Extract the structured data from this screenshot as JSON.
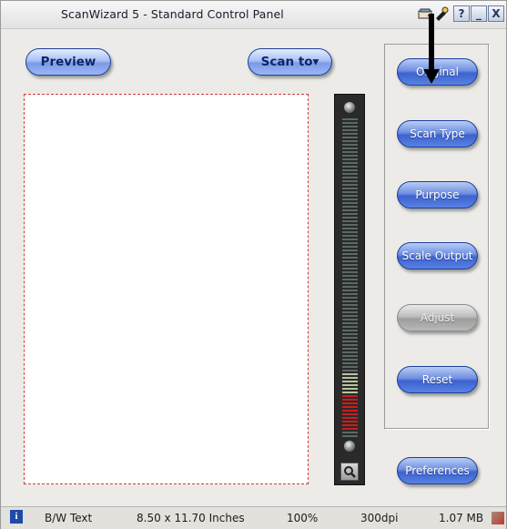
{
  "window": {
    "title": "ScanWizard 5 - Standard Control Panel",
    "controls": {
      "help": "?",
      "minimize": "_",
      "close": "X"
    }
  },
  "toolbar": {
    "preview_label": "Preview",
    "scan_to_label": "Scan to▾"
  },
  "right_panel": {
    "buttons": [
      {
        "label": "Original",
        "enabled": true
      },
      {
        "label": "Scan Type",
        "enabled": true
      },
      {
        "label": "Purpose",
        "enabled": true
      },
      {
        "label": "Scale Output",
        "enabled": true
      },
      {
        "label": "Adjust",
        "enabled": false
      },
      {
        "label": "Reset",
        "enabled": true
      }
    ],
    "preferences_label": "Preferences"
  },
  "zoom_slider": {
    "colors": {
      "active": "#c81e1e",
      "light": "#b9c4a0",
      "dark": "#5c6a66"
    }
  },
  "status": {
    "scan_type": "B/W Text",
    "dimensions": "8.50 x 11.70 Inches",
    "scale": "100%",
    "resolution": "300dpi",
    "file_size": "1.07 MB"
  },
  "icons": [
    "scanner-icon",
    "settings-icon",
    "info-icon",
    "resize-grip-icon",
    "zoom-magnifier-icon"
  ]
}
